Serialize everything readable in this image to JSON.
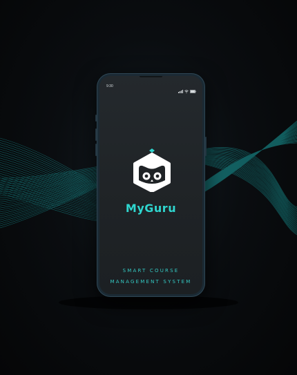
{
  "status_bar": {
    "time": "9:30",
    "icons": [
      "signal-icon",
      "wifi-icon",
      "battery-icon"
    ]
  },
  "app": {
    "name": "MyGuru",
    "tagline_line1": "SMART COURSE",
    "tagline_line2": "MANAGEMENT SYSTEM",
    "logo_icon": "owl-cube-icon"
  },
  "colors": {
    "accent": "#2fd6cf",
    "background": "#050607",
    "screen": "#212629",
    "logo_fill": "#ffffff"
  }
}
